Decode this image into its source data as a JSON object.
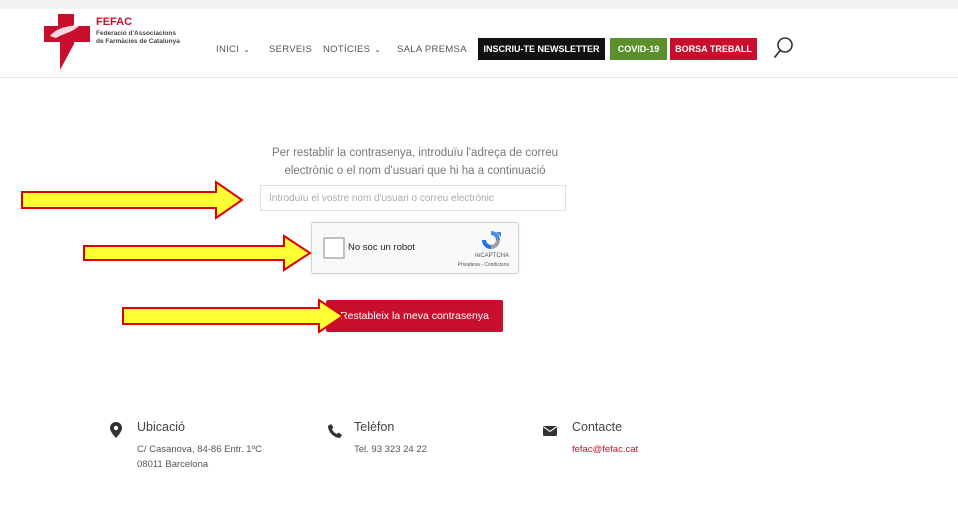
{
  "header": {
    "logo_name": "FEFAC",
    "logo_line1": "Federació d'Associacions",
    "logo_line2": "de Farmàcies de Catalunya",
    "nav": [
      {
        "label": "INICI",
        "has_dropdown": true
      },
      {
        "label": "SERVEIS",
        "has_dropdown": false
      },
      {
        "label": "NOTÍCIES",
        "has_dropdown": true
      },
      {
        "label": "SALA PREMSA",
        "has_dropdown": false
      }
    ],
    "buttons": [
      {
        "label": "INSCRIU-TE NEWSLETTER",
        "color": "#111111"
      },
      {
        "label": "COVID-19",
        "color": "#5a8f2a"
      },
      {
        "label": "BORSA TREBALL",
        "color": "#c8102e"
      }
    ],
    "search_icon": "search-icon"
  },
  "form": {
    "instruction": "Per restablir la contrasenya, introduïu l'adreça de correu electrònic o el nom d'usuari que hi ha a continuació",
    "email_placeholder": "Introduïu el vostre nom d'usuari o correu electrònic",
    "email_value": "",
    "recaptcha": {
      "label": "No soc un robot",
      "brand": "reCAPTCHA",
      "links": "Privadesa - Condicions"
    },
    "submit_label": "Restableix la meva contrasenya",
    "accent_color": "#c8102e"
  },
  "annotations": {
    "arrow_color": "#ffff33",
    "arrow_border": "#e00000"
  },
  "footer": {
    "location": {
      "title": "Ubicació",
      "line1": "C/ Casanova, 84-86 Entr. 1ºC",
      "line2": "08011 Barcelona",
      "icon": "map-pin-icon"
    },
    "phone": {
      "title": "Telèfon",
      "line1": "Tel. 93 323 24 22",
      "icon": "phone-icon"
    },
    "contact": {
      "title": "Contacte",
      "line1": "fefac@fefac.cat",
      "icon": "envelope-icon"
    }
  }
}
